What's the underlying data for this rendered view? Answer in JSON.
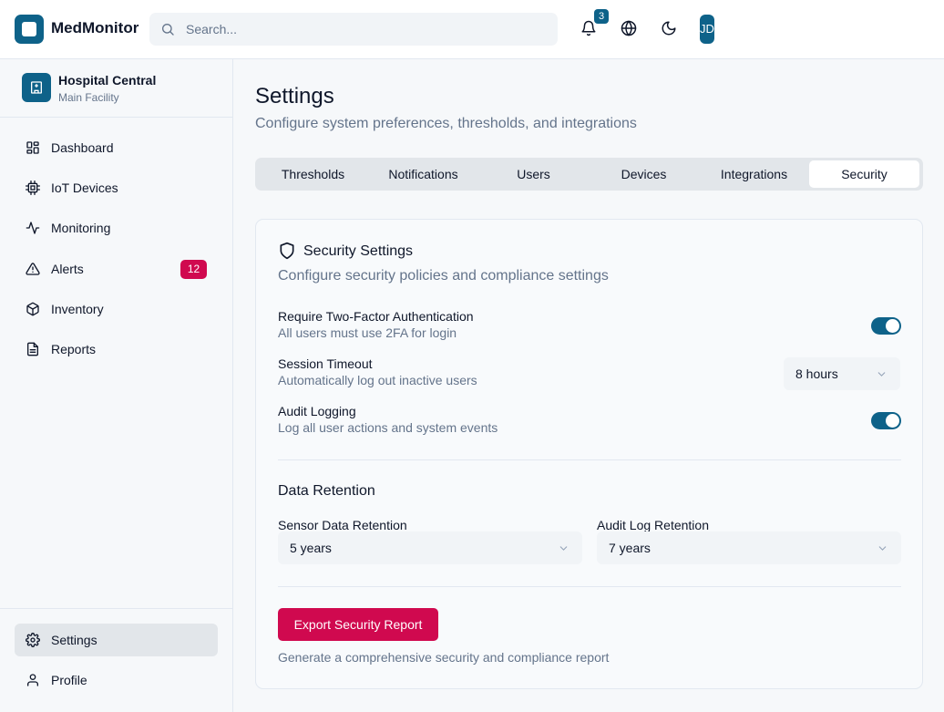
{
  "header": {
    "app_name": "MedMonitor",
    "search_placeholder": "Search...",
    "notification_count": "3",
    "avatar_initials": "JD"
  },
  "sidebar": {
    "facility_name": "Hospital Central",
    "facility_sub": "Main Facility",
    "items": [
      {
        "label": "Dashboard",
        "icon": "dashboard-icon"
      },
      {
        "label": "IoT Devices",
        "icon": "chip-icon"
      },
      {
        "label": "Monitoring",
        "icon": "activity-icon"
      },
      {
        "label": "Alerts",
        "icon": "alert-triangle-icon",
        "badge": "12"
      },
      {
        "label": "Inventory",
        "icon": "package-icon"
      },
      {
        "label": "Reports",
        "icon": "file-text-icon"
      }
    ],
    "bottom_items": [
      {
        "label": "Settings",
        "icon": "gear-icon",
        "active": true
      },
      {
        "label": "Profile",
        "icon": "user-icon"
      }
    ]
  },
  "main": {
    "title": "Settings",
    "subtitle": "Configure system preferences, thresholds, and integrations",
    "tabs": [
      {
        "label": "Thresholds"
      },
      {
        "label": "Notifications"
      },
      {
        "label": "Users"
      },
      {
        "label": "Devices"
      },
      {
        "label": "Integrations"
      },
      {
        "label": "Security",
        "active": true
      }
    ],
    "security": {
      "title": "Security Settings",
      "subtitle": "Configure security policies and compliance settings",
      "two_factor": {
        "label": "Require Two-Factor Authentication",
        "desc": "All users must use 2FA for login",
        "enabled": true
      },
      "session_timeout": {
        "label": "Session Timeout",
        "desc": "Automatically log out inactive users",
        "value": "8 hours"
      },
      "audit_logging": {
        "label": "Audit Logging",
        "desc": "Log all user actions and system events",
        "enabled": true
      },
      "data_retention": {
        "title": "Data Retention",
        "sensor_label": "Sensor Data Retention",
        "sensor_value": "5 years",
        "audit_label": "Audit Log Retention",
        "audit_value": "7 years"
      },
      "export_button": "Export Security Report",
      "export_desc": "Generate a comprehensive security and compliance report"
    }
  },
  "colors": {
    "primary": "#0e6289",
    "danger": "#d0094f",
    "muted_text": "#64748b"
  }
}
